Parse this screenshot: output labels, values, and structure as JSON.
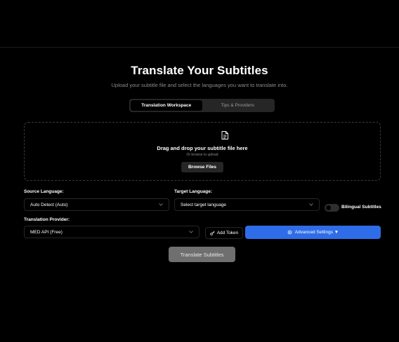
{
  "header": {
    "title": "Translate Your Subtitles",
    "subtitle": "Upload your subtitle file and select the languages you want to translate into."
  },
  "tabs": [
    {
      "label": "Translation Workspace",
      "active": true
    },
    {
      "label": "Tips & Providers",
      "active": false
    }
  ],
  "upload": {
    "title": "Drag and drop your subtitle file here",
    "hint": "Or browse to upload",
    "browse_label": "Browse Files",
    "icon": "file-icon"
  },
  "source_language": {
    "label": "Source Language:",
    "value": "Auto Detect (Auto)"
  },
  "target_language": {
    "label": "Target Language:",
    "value": "Select target language"
  },
  "bilingual": {
    "label": "Bilingual Subtitles",
    "enabled": false
  },
  "provider": {
    "label": "Translation Provider:",
    "value": "MED API (Free)"
  },
  "add_token": {
    "label": "Add Token",
    "icon": "key-icon"
  },
  "advanced": {
    "label": "Advanced Settings ▼",
    "icon": "gear-icon"
  },
  "translate_button": "Translate Subtitles",
  "colors": {
    "background": "#000000",
    "accent": "#2f6de8",
    "muted_text": "#8a8a8a",
    "disabled_button": "#6f6f6f"
  }
}
